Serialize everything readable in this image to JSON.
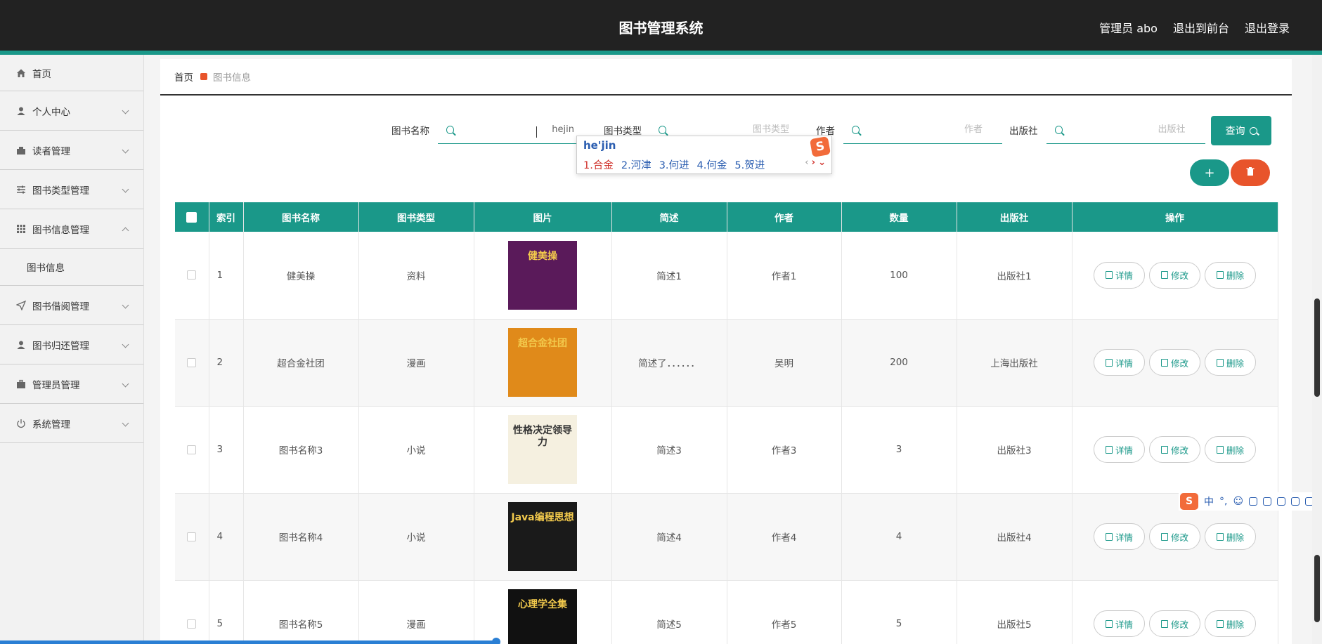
{
  "header": {
    "title": "图书管理系统",
    "user_label": "管理员 abo",
    "to_front_label": "退出到前台",
    "logout_label": "退出登录"
  },
  "sidebar": {
    "items": [
      {
        "label": "首页",
        "icon": "home-icon"
      },
      {
        "label": "个人中心",
        "icon": "user-icon"
      },
      {
        "label": "读者管理",
        "icon": "reader-icon"
      },
      {
        "label": "图书类型管理",
        "icon": "sliders-icon"
      },
      {
        "label": "图书信息管理",
        "icon": "grid-icon",
        "expanded": true,
        "children": [
          "图书信息"
        ]
      },
      {
        "label": "图书借阅管理",
        "icon": "send-icon"
      },
      {
        "label": "图书归还管理",
        "icon": "user-icon"
      },
      {
        "label": "管理员管理",
        "icon": "briefcase-icon"
      },
      {
        "label": "系统管理",
        "icon": "power-icon"
      }
    ]
  },
  "breadcrumb": {
    "home": "首页",
    "current": "图书信息"
  },
  "search": {
    "book_name_label": "图书名称",
    "book_name_value": "hejin",
    "book_type_label": "图书类型",
    "book_type_placeholder": "图书类型",
    "author_label": "作者",
    "author_placeholder": "作者",
    "publisher_label": "出版社",
    "publisher_placeholder": "出版社",
    "query_label": "查询"
  },
  "ime": {
    "composition": "he'jin",
    "candidates": [
      "1.合金",
      "2.河津",
      "3.何进",
      "4.何金",
      "5.贺进"
    ],
    "bar_chars": [
      "中",
      "°,",
      "☺",
      "🎤",
      "⌨",
      "👤",
      "👕",
      "▦"
    ]
  },
  "actions": {
    "add_label": "+",
    "delete_label": "🗑"
  },
  "table": {
    "columns": [
      "",
      "索引",
      "图书名称",
      "图书类型",
      "图片",
      "简述",
      "作者",
      "数量",
      "出版社",
      "操作"
    ],
    "action_labels": {
      "detail": "详情",
      "edit": "修改",
      "delete": "删除"
    },
    "rows": [
      {
        "index": "1",
        "name": "健美操",
        "type": "资料",
        "summary": "简述1",
        "author": "作者1",
        "qty": "100",
        "publisher": "出版社1",
        "cover_title": "健美操",
        "cover_color": "#5a1a5a"
      },
      {
        "index": "2",
        "name": "超合金社团",
        "type": "漫画",
        "summary": "简述了．．．．．．",
        "author": "吴明",
        "qty": "200",
        "publisher": "上海出版社",
        "cover_title": "超合金社团",
        "cover_color": "#e08a1a"
      },
      {
        "index": "3",
        "name": "图书名称3",
        "type": "小说",
        "summary": "简述3",
        "author": "作者3",
        "qty": "3",
        "publisher": "出版社3",
        "cover_title": "性格决定领导力",
        "cover_color": "#f5f0e0"
      },
      {
        "index": "4",
        "name": "图书名称4",
        "type": "小说",
        "summary": "简述4",
        "author": "作者4",
        "qty": "4",
        "publisher": "出版社4",
        "cover_title": "Java编程思想",
        "cover_color": "#1a1a1a"
      },
      {
        "index": "5",
        "name": "图书名称5",
        "type": "漫画",
        "summary": "简述5",
        "author": "作者5",
        "qty": "5",
        "publisher": "出版社5",
        "cover_title": "心理学全集",
        "cover_color": "#111111"
      }
    ]
  },
  "colors": {
    "accent": "#1a9889",
    "danger": "#e8542b",
    "header_bg": "#222222"
  }
}
